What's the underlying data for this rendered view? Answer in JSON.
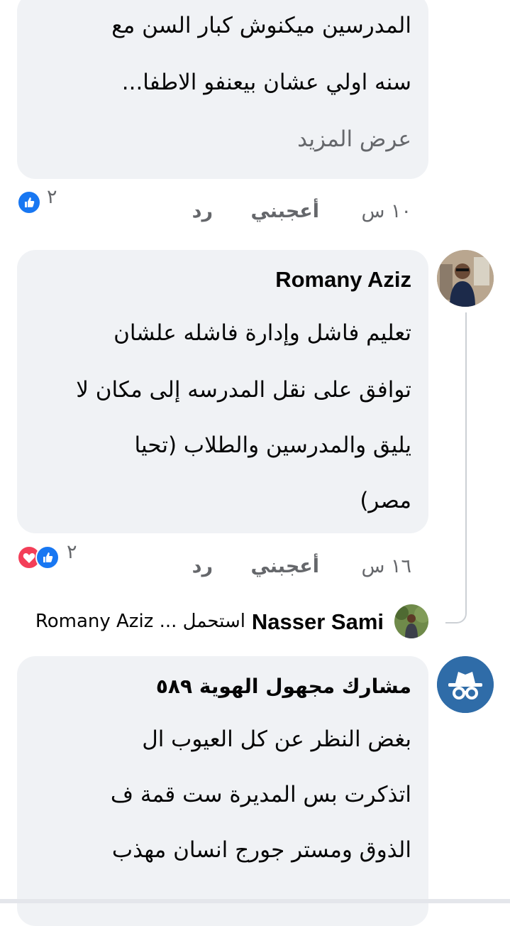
{
  "comments": [
    {
      "author": "",
      "lines": [
        "المدرسين ميكنوش كبار السن مع",
        "سنه اولي عشان بيعنفو الاطفا..."
      ],
      "see_more": "عرض المزيد",
      "time": "١٠ س",
      "like": "أعجبني",
      "reply": "رد",
      "reaction_count": "٢",
      "reactions": [
        "like-icon"
      ]
    },
    {
      "author": "Romany Aziz",
      "lines": [
        "تعليم فاشل وإدارة فاشله علشان",
        "توافق على نقل المدرسه إلى مكان لا",
        "يليق والمدرسين والطلاب (تحيا",
        "مصر)"
      ],
      "time": "١٦ س",
      "like": "أعجبني",
      "reply": "رد",
      "reaction_count": "٢",
      "reactions": [
        "like-icon",
        "love-icon"
      ]
    },
    {
      "author": "مشارك مجهول الهوية ٥٨٩",
      "lines": [
        "بغض النظر عن كل العيوب ال",
        "اتذكرت بس المديرة ست قمة ف",
        "الذوق ومستر جورج انسان مهذب"
      ]
    }
  ],
  "reply_preview": {
    "author": "Nasser Sami",
    "text": "استحمل ... Romany Aziz"
  },
  "colors": {
    "bubble": "#f0f2f5",
    "like_blue": "#1877f2",
    "love_red": "#f33e58",
    "meta_gray": "#65676b"
  }
}
